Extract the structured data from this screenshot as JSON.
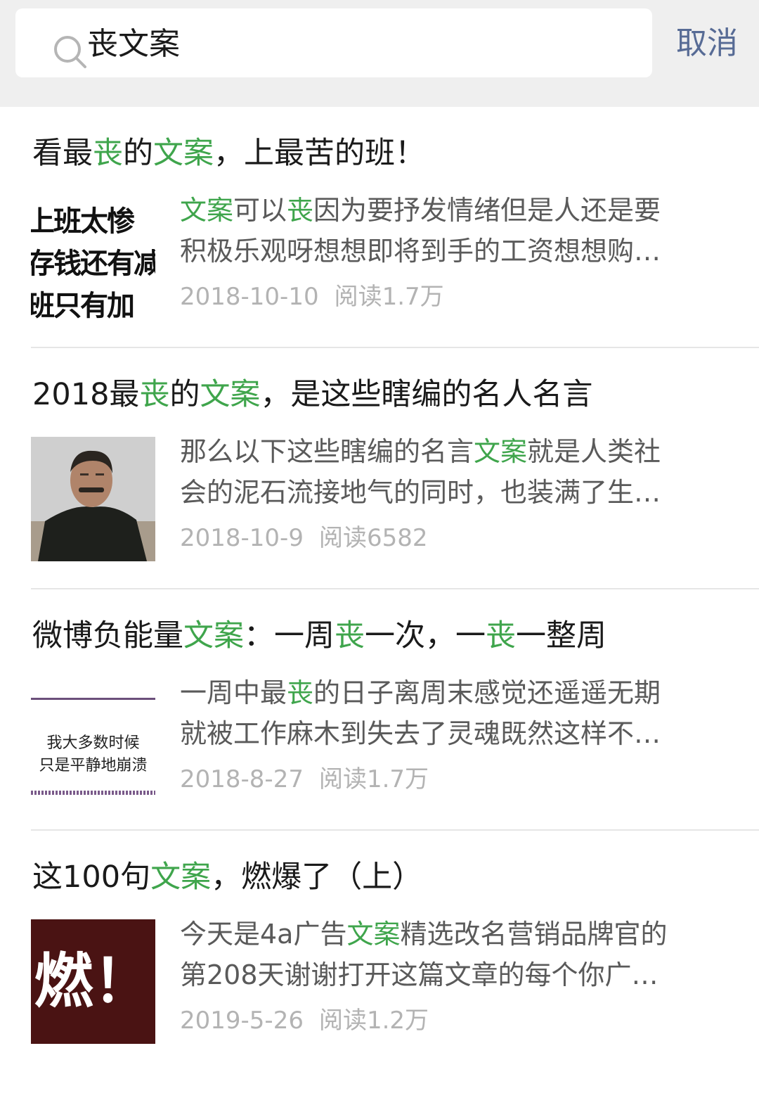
{
  "search": {
    "query": "丧文案",
    "cancel_label": "取消"
  },
  "results": [
    {
      "title_parts": [
        "看最",
        "丧",
        "的",
        "文案",
        "，上最苦的班！"
      ],
      "desc_lines": [
        [
          "",
          "文案",
          "可以",
          "丧",
          "因为要抒发情绪但是人还是要"
        ],
        [
          "积极乐观呀想想即将到手的工资想想购…"
        ]
      ],
      "date": "2018-10-10",
      "reads": "阅读1.7万",
      "thumb_text": [
        "上班太惨",
        "存钱还有减",
        "班只有加"
      ]
    },
    {
      "title_parts": [
        "2018最",
        "丧",
        "的",
        "文案",
        "，是这些瞎编的名人名言"
      ],
      "desc_lines": [
        [
          "那么以下这些瞎编的名言",
          "文案",
          "就是人类社"
        ],
        [
          "会的泥石流接地气的同时，也装满了生…"
        ]
      ],
      "date": "2018-10-9",
      "reads": "阅读6582"
    },
    {
      "title_parts": [
        "微博负能量",
        "文案",
        "：一周",
        "丧",
        "一次，一",
        "丧",
        "一整周"
      ],
      "desc_lines": [
        [
          "一周中最",
          "丧",
          "的日子离周末感觉还遥遥无期"
        ],
        [
          "就被工作麻木到失去了灵魂既然这样不…"
        ]
      ],
      "date": "2018-8-27",
      "reads": "阅读1.7万",
      "thumb_text": [
        "我大多数时候",
        "只是平静地崩溃"
      ]
    },
    {
      "title_parts": [
        "这100句",
        "文案",
        "，燃爆了（上）"
      ],
      "desc_lines": [
        [
          "今天是4a广告",
          "文案",
          "精选改名营销品牌官的"
        ],
        [
          "第208天谢谢打开这篇文章的每个你广…"
        ]
      ],
      "date": "2019-5-26",
      "reads": "阅读1.2万",
      "thumb_text": [
        "燃！"
      ]
    }
  ],
  "colors": {
    "highlight": "#3fa54c",
    "link": "#576b95",
    "meta": "#b3b3b3"
  }
}
